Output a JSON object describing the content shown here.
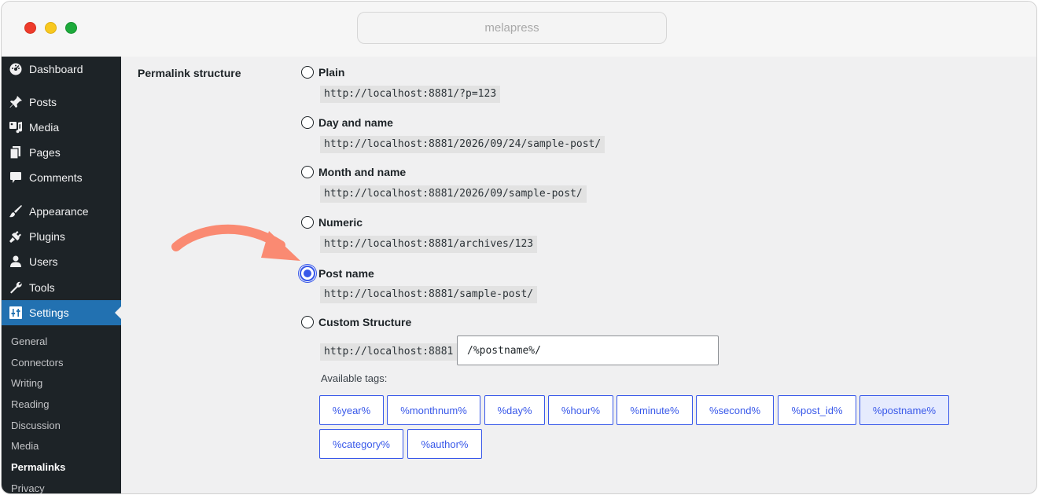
{
  "browser": {
    "url": "melapress"
  },
  "sidebar": {
    "items": [
      {
        "label": "Dashboard",
        "icon": "dashboard-icon"
      },
      {
        "label": "Posts",
        "icon": "pin-icon"
      },
      {
        "label": "Media",
        "icon": "media-icon"
      },
      {
        "label": "Pages",
        "icon": "pages-icon"
      },
      {
        "label": "Comments",
        "icon": "comment-icon"
      },
      {
        "label": "Appearance",
        "icon": "brush-icon"
      },
      {
        "label": "Plugins",
        "icon": "plugin-icon"
      },
      {
        "label": "Users",
        "icon": "user-icon"
      },
      {
        "label": "Tools",
        "icon": "wrench-icon"
      },
      {
        "label": "Settings",
        "icon": "settings-icon"
      }
    ],
    "submenu": [
      "General",
      "Connectors",
      "Writing",
      "Reading",
      "Discussion",
      "Media",
      "Permalinks",
      "Privacy"
    ],
    "active_item": "Settings",
    "current_submenu": "Permalinks"
  },
  "permalinks": {
    "field_label": "Permalink structure",
    "options": [
      {
        "label": "Plain",
        "example": "http://localhost:8881/?p=123",
        "checked": false
      },
      {
        "label": "Day and name",
        "example": "http://localhost:8881/2026/09/24/sample-post/",
        "checked": false
      },
      {
        "label": "Month and name",
        "example": "http://localhost:8881/2026/09/sample-post/",
        "checked": false
      },
      {
        "label": "Numeric",
        "example": "http://localhost:8881/archives/123",
        "checked": false
      },
      {
        "label": "Post name",
        "example": "http://localhost:8881/sample-post/",
        "checked": true
      },
      {
        "label": "Custom Structure",
        "checked": false
      }
    ],
    "custom": {
      "base": "http://localhost:8881",
      "value": "/%postname%/"
    },
    "available_tags_label": "Available tags:",
    "tags": [
      "%year%",
      "%monthnum%",
      "%day%",
      "%hour%",
      "%minute%",
      "%second%",
      "%post_id%",
      "%postname%",
      "%category%",
      "%author%"
    ],
    "pressed_tag": "%postname%"
  },
  "colors": {
    "accent": "#3858e9",
    "sidebar_bg": "#1d2327",
    "sidebar_active": "#2271b1",
    "annotation_arrow": "#fa8a72"
  }
}
